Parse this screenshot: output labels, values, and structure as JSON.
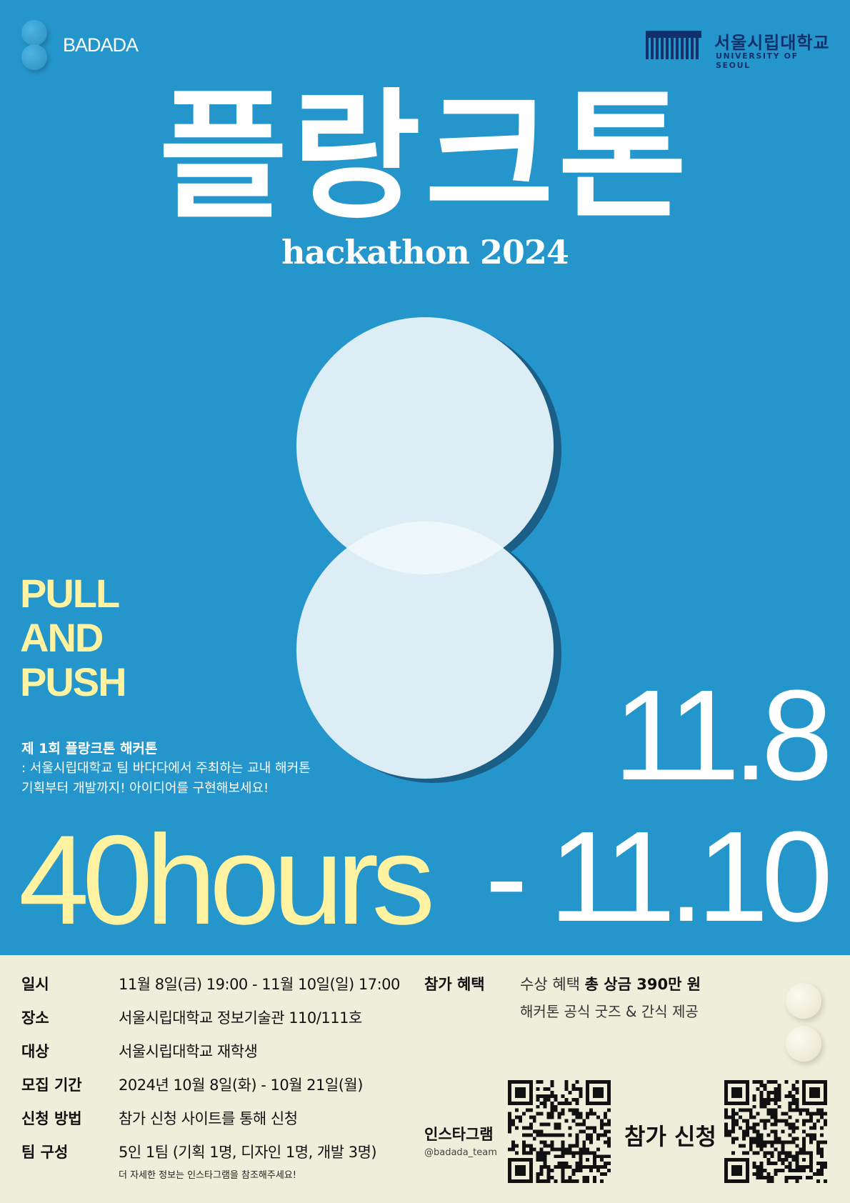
{
  "brand": {
    "name": "BADADA"
  },
  "university": {
    "name_kor": "서울시립대학교",
    "name_eng": "UNIVERSITY OF SEOUL"
  },
  "hero": {
    "title": "플랑크톤",
    "subtitle": "hackathon 2024"
  },
  "slogan": [
    "PULL",
    "AND",
    "PUSH"
  ],
  "description": {
    "title": "제 1회 플랑크톤 해커톤",
    "line1": ": 서울시립대학교 팀 바다다에서 주최하는 교내 해커톤",
    "line2": "기획부터 개발까지!  아이디어를 구현해보세요!"
  },
  "dates": {
    "start": "11.8",
    "end": "- 11.10"
  },
  "duration": "40hours",
  "info": [
    {
      "label": "일시",
      "value": "11월 8일(금) 19:00 - 11월 10일(일) 17:00"
    },
    {
      "label": "장소",
      "value": "서울시립대학교 정보기술관 110/111호"
    },
    {
      "label": "대상",
      "value": "서울시립대학교 재학생"
    },
    {
      "label": "모집 기간",
      "value": "2024년 10월 8일(화) - 10월 21일(월)"
    },
    {
      "label": "신청 방법",
      "value": "참가 신청 사이트를 통해 신청"
    },
    {
      "label": "팀 구성",
      "value": "5인 1팀 (기획 1명, 디자인 1명, 개발 3명)"
    }
  ],
  "note": "더 자세한 정보는 인스타그램을 참조해주세요!",
  "benefits": {
    "label": "참가 혜택",
    "line1_prefix": "수상 혜택",
    "line1_highlight": "총 상금 390만 원",
    "line2": "해커톤 공식 굿즈 & 간식 제공"
  },
  "instagram": {
    "label": "인스타그램",
    "handle": "@badada_team"
  },
  "apply": {
    "label": "참가 신청"
  },
  "colors": {
    "background_blue": "#2496cc",
    "cream": "#efeedb",
    "accent_yellow": "#fff3a2",
    "circle_fill": "#dcedf6",
    "circle_shadow": "#1b5f87",
    "navy": "#12306b"
  }
}
